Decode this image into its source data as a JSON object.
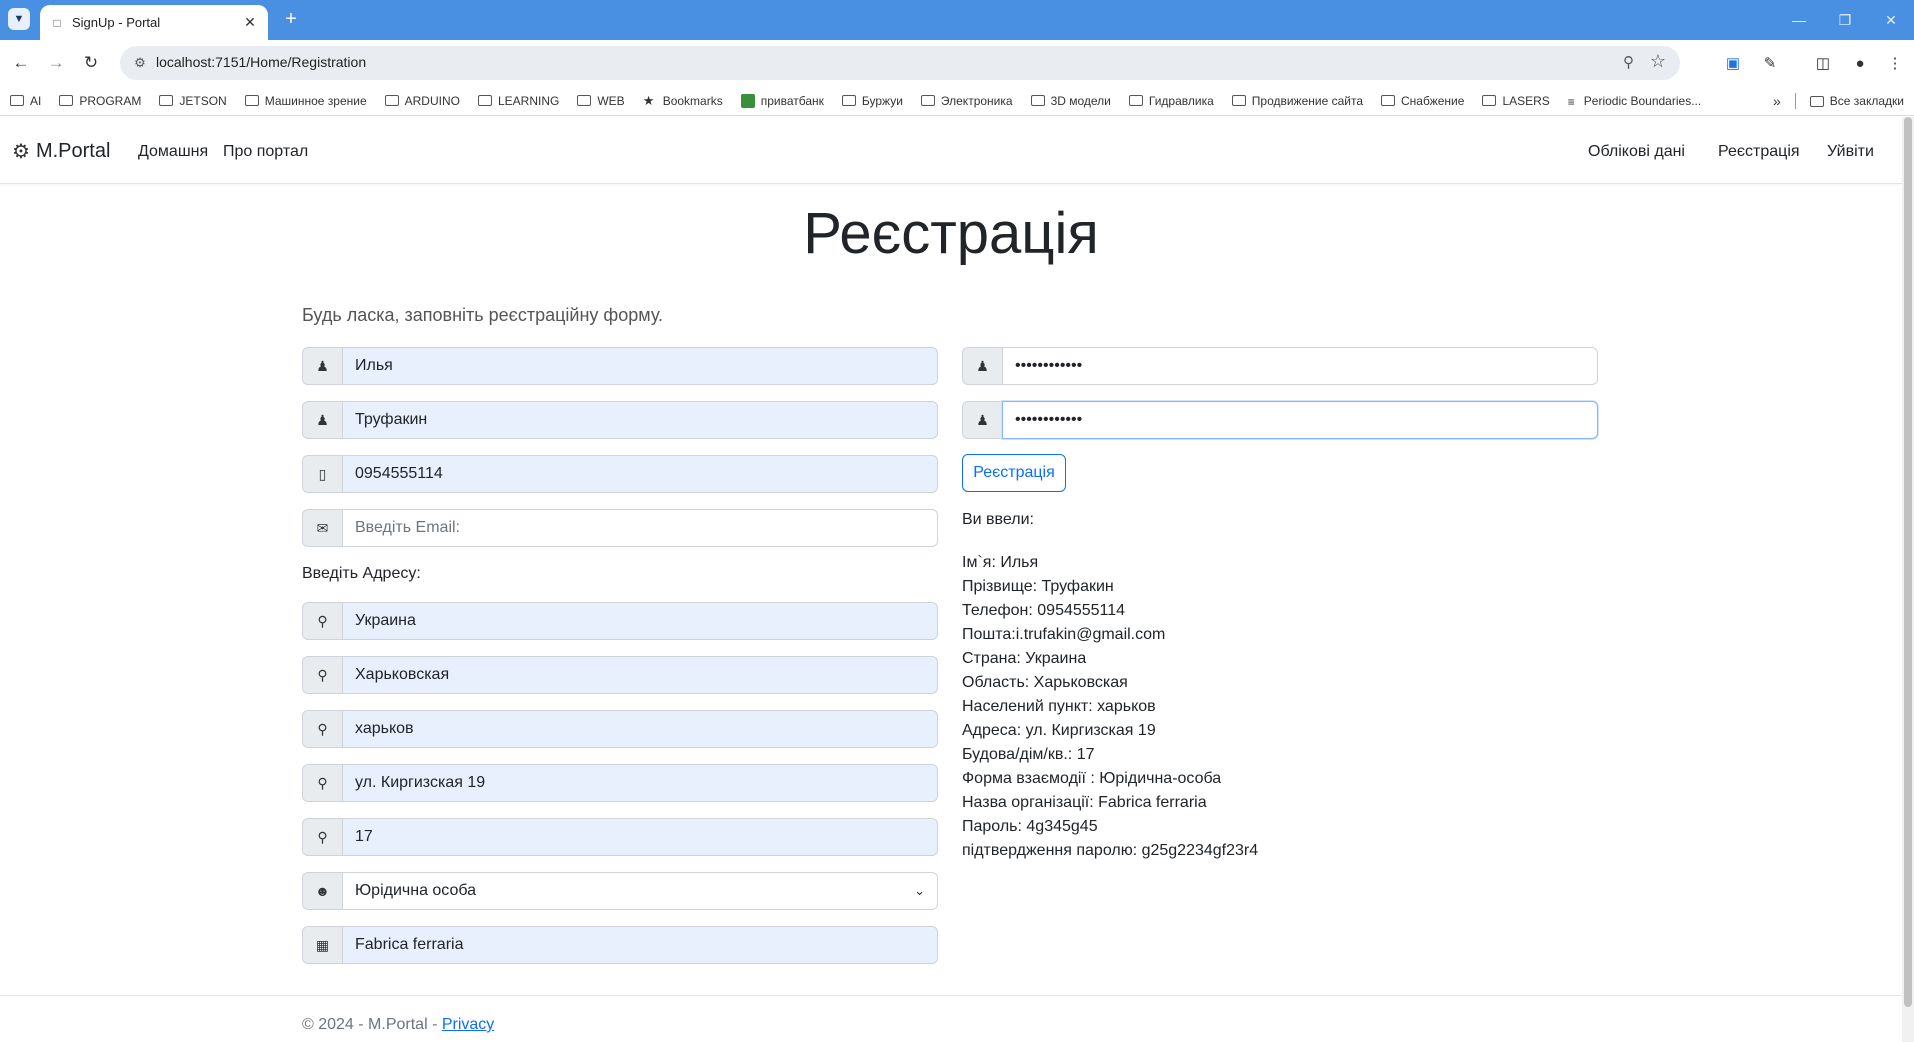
{
  "browser": {
    "tab_title": "SignUp - Portal",
    "url": "localhost:7151/Home/Registration",
    "bookmarks": [
      {
        "label": "AI",
        "icon": "folder-icon"
      },
      {
        "label": "PROGRAM",
        "icon": "folder-icon"
      },
      {
        "label": "JETSON",
        "icon": "folder-icon"
      },
      {
        "label": "Машинное зрение",
        "icon": "folder-icon"
      },
      {
        "label": "ARDUINO",
        "icon": "folder-icon"
      },
      {
        "label": "LEARNING",
        "icon": "folder-icon"
      },
      {
        "label": "WEB",
        "icon": "folder-icon"
      },
      {
        "label": "Bookmarks",
        "icon": "star-icon"
      },
      {
        "label": "приватбанк",
        "icon": "privatbank-icon"
      },
      {
        "label": "Буржуи",
        "icon": "folder-icon"
      },
      {
        "label": "Электроника",
        "icon": "folder-icon"
      },
      {
        "label": "3D модели",
        "icon": "folder-icon"
      },
      {
        "label": "Гидравлика",
        "icon": "folder-icon"
      },
      {
        "label": "Продвижение сайта",
        "icon": "folder-icon"
      },
      {
        "label": "Снабжение",
        "icon": "folder-icon"
      },
      {
        "label": "LASERS",
        "icon": "folder-icon"
      },
      {
        "label": "Periodic Boundaries...",
        "icon": "page-icon"
      }
    ],
    "all_bookmarks": "Все закладки"
  },
  "navbar": {
    "brand": "M.Portal",
    "links_left": [
      "Домашня",
      "Про портал"
    ],
    "links_right": [
      "Облікові дані",
      "Реєстрація",
      "Уйвіти"
    ]
  },
  "page": {
    "title": "Реєстрація",
    "lead": "Будь ласка, заповніть реєстраційну форму.",
    "address_label": "Введіть Адресу:",
    "register_button": "Реєстрація",
    "you_entered": "Ви ввели:"
  },
  "form": {
    "first_name": "Илья",
    "last_name": "Труфакин",
    "phone": "0954555114",
    "email_placeholder": "Введіть Email:",
    "country": "Украина",
    "region": "Харьковская",
    "city": "харьков",
    "street": "ул. Киргизская 19",
    "building": "17",
    "entity_type": "Юрідична особа",
    "organization": "Fabrica ferraria",
    "password_mask": "••••••••••••",
    "password_confirm_mask": "••••••••••••"
  },
  "summary": [
    "Ім`я: Илья",
    "Прізвище: Труфакин",
    "Телефон: 0954555114",
    "Пошта:i.trufakin@gmail.com",
    "Страна: Украина",
    "Область: Харьковская",
    "Населений пункт: харьков",
    "Адреса: ул. Киргизская 19",
    "Будова/дім/кв.: 17",
    "Форма взаємодії : Юрідична-особа",
    "Назва організації: Fabrica ferraria",
    "Пароль: 4g345g45",
    "підтвердження паролю: g25g2234gf23r4"
  ],
  "footer": {
    "text": "© 2024 - M.Portal - ",
    "privacy": "Privacy"
  },
  "colors": {
    "chrome_blue": "#4a90e2",
    "primary": "#0d6efd",
    "autofill": "#e8f0fe"
  }
}
